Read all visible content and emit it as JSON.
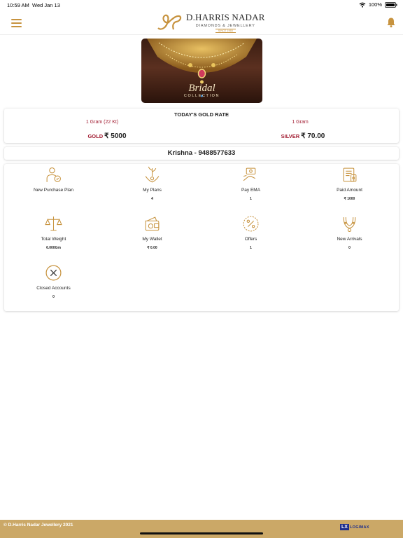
{
  "status_bar": {
    "time": "10:59 AM",
    "date": "Wed Jan 13",
    "battery": "100%"
  },
  "header": {
    "brand_name": "D.HARRIS NADAR",
    "brand_tagline": "DIAMONDS & JEWELLERY",
    "brand_since": "SINCE 1965",
    "icons": {
      "menu": "hamburger-menu-icon",
      "notifications": "bell-icon"
    },
    "accent_color": "#c7933f"
  },
  "banner": {
    "title": "Bridal",
    "subtitle": "COLLECTION"
  },
  "gold_rate": {
    "title": "TODAY'S GOLD RATE",
    "gold": {
      "unit": "1 Gram (22 Kt)",
      "label": "GOLD",
      "price": "₹ 5000"
    },
    "silver": {
      "unit": "1 Gram",
      "label": "SILVER",
      "price": "₹ 70.00"
    },
    "label_color": "#a21e33"
  },
  "user": {
    "name_phone": "Krishna - 9488577633"
  },
  "tiles": [
    {
      "label": "New Purchase Plan",
      "value": "",
      "icon": "new-purchase-plan-icon"
    },
    {
      "label": "My Plans",
      "value": "4",
      "icon": "my-plans-icon"
    },
    {
      "label": "Pay EMA",
      "value": "1",
      "icon": "pay-ema-icon"
    },
    {
      "label": "Paid Amount",
      "value": "₹ 1000",
      "icon": "paid-amount-icon"
    },
    {
      "label": "Total Weight",
      "value": "6.000Gm",
      "icon": "balance-scale-icon"
    },
    {
      "label": "My Wallet",
      "value": "₹ 0.00",
      "icon": "wallet-icon"
    },
    {
      "label": "Offers",
      "value": "1",
      "icon": "percent-offer-icon"
    },
    {
      "label": "New Arrivals",
      "value": "0",
      "icon": "necklace-icon"
    },
    {
      "label": "Closed Accounts",
      "value": "0",
      "icon": "close-circle-icon"
    }
  ],
  "footer": {
    "copyright": "© D.Harris Nadar Jewellery 2021",
    "partner_mark": "LX",
    "partner_name": "LOGIMAX",
    "background": "#cba867"
  }
}
